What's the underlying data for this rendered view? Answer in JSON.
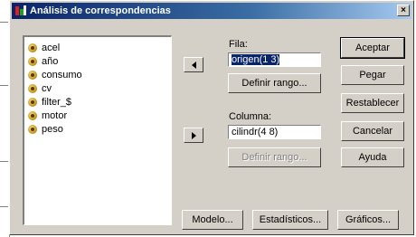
{
  "window": {
    "title": "Análisis de correspondencias",
    "close_glyph": "×",
    "icon": "spss-dialog-icon"
  },
  "variables": {
    "items": [
      {
        "label": "acel",
        "icon": "scale-variable-icon"
      },
      {
        "label": "año",
        "icon": "scale-variable-icon"
      },
      {
        "label": "consumo",
        "icon": "scale-variable-icon"
      },
      {
        "label": "cv",
        "icon": "scale-variable-icon"
      },
      {
        "label": "filter_$",
        "icon": "scale-variable-icon"
      },
      {
        "label": "motor",
        "icon": "scale-variable-icon"
      },
      {
        "label": "peso",
        "icon": "scale-variable-icon"
      }
    ]
  },
  "fila": {
    "label": "Fila:",
    "value": "origen(1 3)",
    "define_range_label": "Definir rango..."
  },
  "columna": {
    "label": "Columna:",
    "value": "cilindr(4 8)",
    "define_range_label": "Definir rango..."
  },
  "buttons": {
    "ok": "Aceptar",
    "paste": "Pegar",
    "reset": "Restablecer",
    "cancel": "Cancelar",
    "help": "Ayuda",
    "model": "Modelo...",
    "statistics": "Estadísticos...",
    "plots": "Gráficos..."
  },
  "colors": {
    "titlebar_start": "#0a246a",
    "titlebar_end": "#a6caf0",
    "dialog_face": "#d4d0c8",
    "selection": "#0a246a"
  }
}
